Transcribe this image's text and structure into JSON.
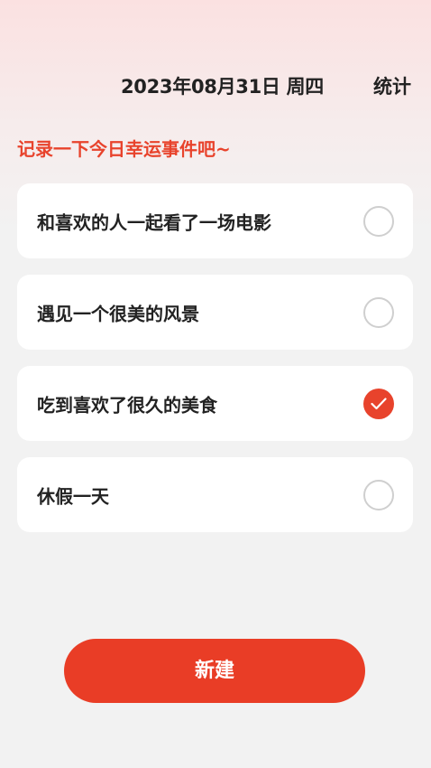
{
  "header": {
    "date": "2023年08月31日 周四",
    "stats_label": "统计"
  },
  "prompt": "记录一下今日幸运事件吧~",
  "events": [
    {
      "label": "和喜欢的人一起看了一场电影",
      "checked": false
    },
    {
      "label": "遇见一个很美的风景",
      "checked": false
    },
    {
      "label": "吃到喜欢了很久的美食",
      "checked": true
    },
    {
      "label": "休假一天",
      "checked": false
    }
  ],
  "new_button_label": "新建",
  "colors": {
    "accent": "#e93d26",
    "check_border": "#cfcfcf"
  }
}
